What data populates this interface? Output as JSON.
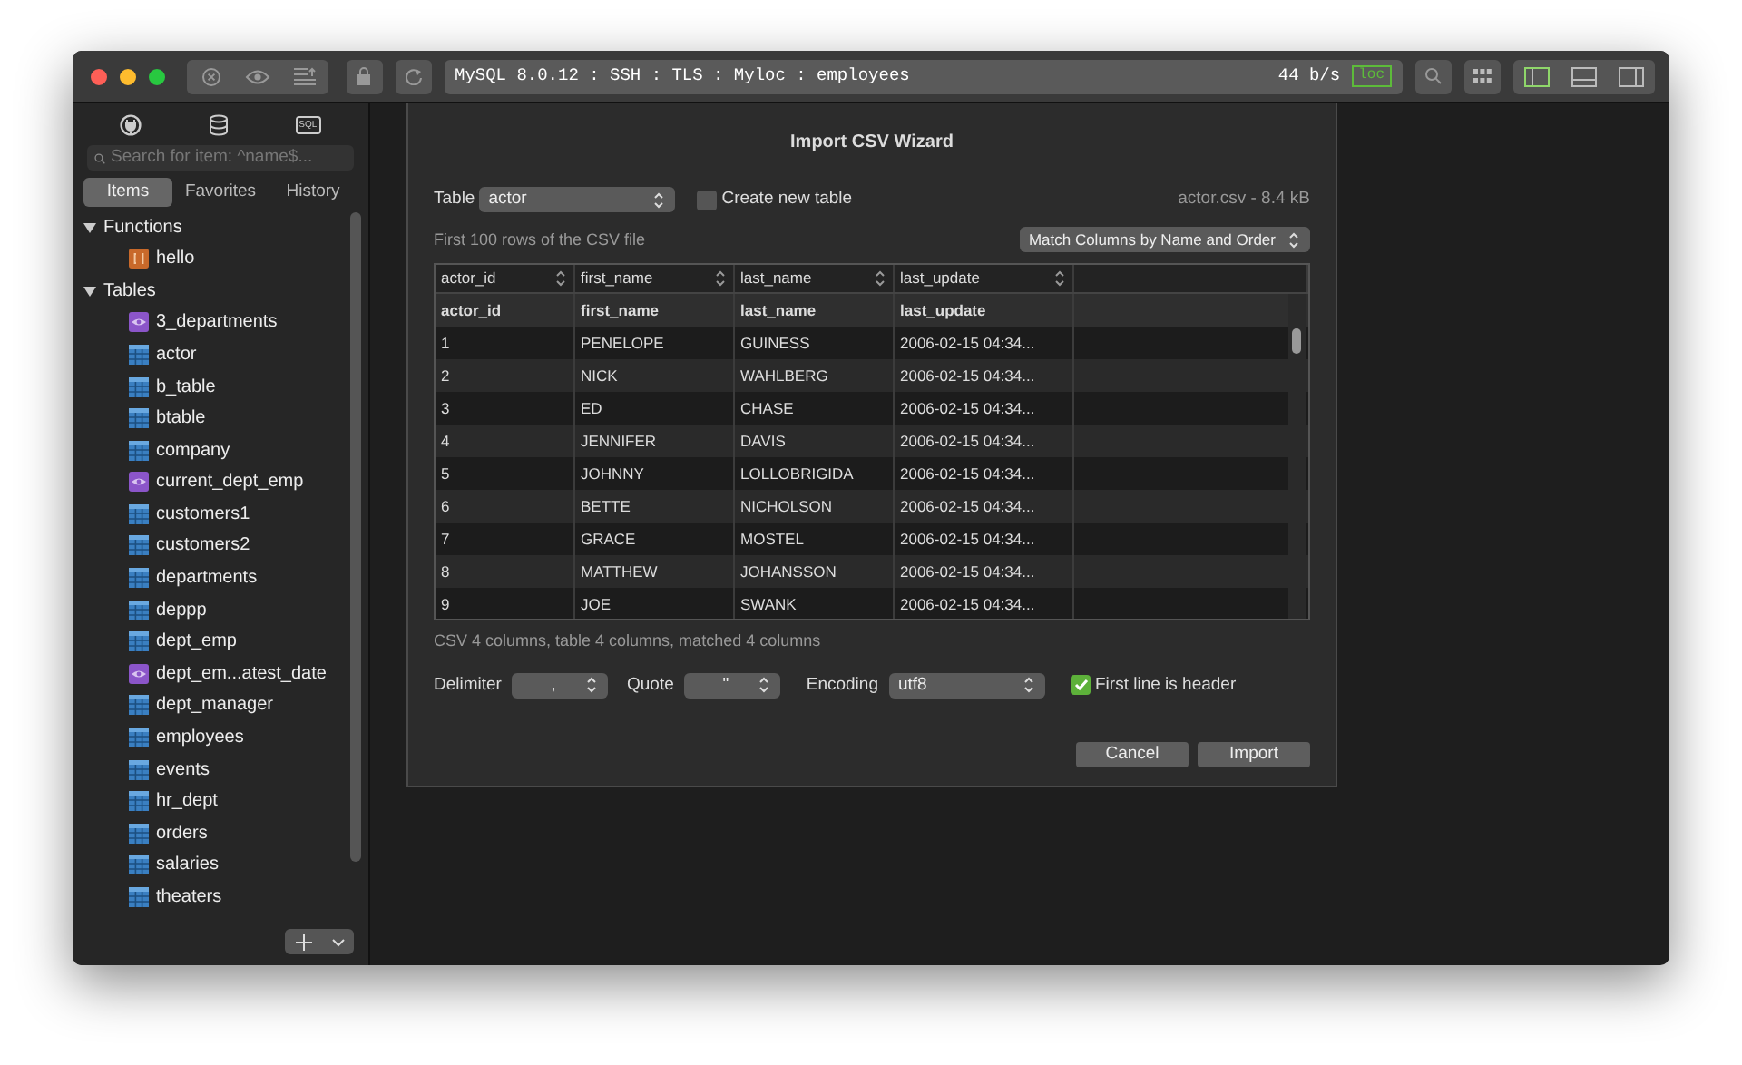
{
  "toolbar": {
    "connection": "MySQL 8.0.12 : SSH : TLS : Myloc : employees",
    "speed": "44 b/s",
    "badge": "loc",
    "layout_toggles": [
      {
        "selected": true
      },
      {
        "selected": false
      },
      {
        "selected": false
      }
    ]
  },
  "sidebar": {
    "sql_label": "SQL",
    "search": {
      "placeholder": "Search for item: ^name$..."
    },
    "tabs": [
      {
        "label": "Items",
        "selected": true
      },
      {
        "label": "Favorites",
        "selected": false
      },
      {
        "label": "History",
        "selected": false
      }
    ],
    "tree": [
      {
        "label": "Functions",
        "expanded": true,
        "children": [
          {
            "label": "hello",
            "kind": "function"
          }
        ]
      },
      {
        "label": "Tables",
        "expanded": true,
        "children": [
          {
            "label": "3_departments",
            "kind": "view"
          },
          {
            "label": "actor",
            "kind": "table"
          },
          {
            "label": "b_table",
            "kind": "table"
          },
          {
            "label": "btable",
            "kind": "table"
          },
          {
            "label": "company",
            "kind": "table"
          },
          {
            "label": "current_dept_emp",
            "kind": "view"
          },
          {
            "label": "customers1",
            "kind": "table"
          },
          {
            "label": "customers2",
            "kind": "table"
          },
          {
            "label": "departments",
            "kind": "table"
          },
          {
            "label": "deppp",
            "kind": "table"
          },
          {
            "label": "dept_emp",
            "kind": "table"
          },
          {
            "label": "dept_em...atest_date",
            "kind": "view"
          },
          {
            "label": "dept_manager",
            "kind": "table"
          },
          {
            "label": "employees",
            "kind": "table"
          },
          {
            "label": "events",
            "kind": "table"
          },
          {
            "label": "hr_dept",
            "kind": "table"
          },
          {
            "label": "orders",
            "kind": "table"
          },
          {
            "label": "salaries",
            "kind": "table"
          },
          {
            "label": "theaters",
            "kind": "table"
          }
        ]
      }
    ]
  },
  "dialog": {
    "title": "Import CSV Wizard",
    "table_label": "Table",
    "table_value": "actor",
    "create_new_table": {
      "label": "Create new table",
      "checked": false
    },
    "file_info": "actor.csv -  8.4 kB",
    "preview_note": "First 100 rows of the CSV file",
    "match_mode": "Match Columns by Name and Order",
    "column_mappings": [
      "actor_id",
      "first_name",
      "last_name",
      "last_update"
    ],
    "rows": [
      {
        "kind": "header",
        "cells": [
          "actor_id",
          "first_name",
          "last_name",
          "last_update"
        ]
      },
      {
        "kind": "data",
        "cells": [
          "1",
          "PENELOPE",
          "GUINESS",
          "2006-02-15 04:34..."
        ]
      },
      {
        "kind": "data",
        "cells": [
          "2",
          "NICK",
          "WAHLBERG",
          "2006-02-15 04:34..."
        ]
      },
      {
        "kind": "data",
        "cells": [
          "3",
          "ED",
          "CHASE",
          "2006-02-15 04:34..."
        ]
      },
      {
        "kind": "data",
        "cells": [
          "4",
          "JENNIFER",
          "DAVIS",
          "2006-02-15 04:34..."
        ]
      },
      {
        "kind": "data",
        "cells": [
          "5",
          "JOHNNY",
          "LOLLOBRIGIDA",
          "2006-02-15 04:34..."
        ]
      },
      {
        "kind": "data",
        "cells": [
          "6",
          "BETTE",
          "NICHOLSON",
          "2006-02-15 04:34..."
        ]
      },
      {
        "kind": "data",
        "cells": [
          "7",
          "GRACE",
          "MOSTEL",
          "2006-02-15 04:34..."
        ]
      },
      {
        "kind": "data",
        "cells": [
          "8",
          "MATTHEW",
          "JOHANSSON",
          "2006-02-15 04:34..."
        ]
      },
      {
        "kind": "data",
        "cells": [
          "9",
          "JOE",
          "SWANK",
          "2006-02-15 04:34..."
        ]
      }
    ],
    "summary": "CSV 4 columns, table 4 columns, matched 4 columns",
    "delimiter": {
      "label": "Delimiter",
      "value": ","
    },
    "quote": {
      "label": "Quote",
      "value": "\""
    },
    "encoding": {
      "label": "Encoding",
      "value": "utf8"
    },
    "first_line_header": {
      "label": "First line is header",
      "checked": true
    },
    "buttons": [
      "Cancel",
      "Import"
    ]
  }
}
